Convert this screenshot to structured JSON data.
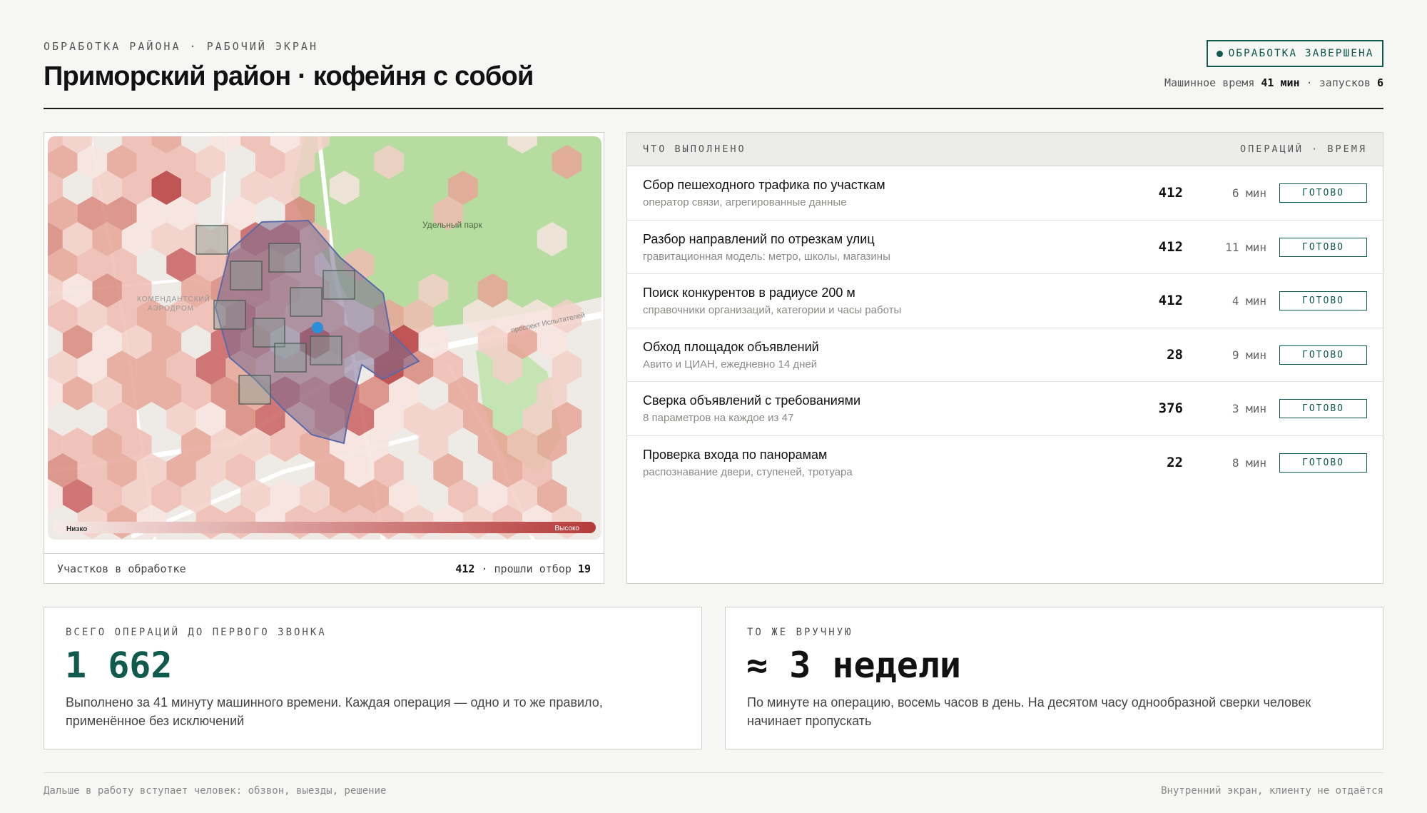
{
  "header": {
    "kicker": "ОБРАБОТКА РАЙОНА · РАБОЧИЙ ЭКРАН",
    "title": "Приморский район · кофейня с собой",
    "status_badge": "ОБРАБОТКА ЗАВЕРШЕНА",
    "machine_time_label": "Машинное время",
    "machine_time_value": "41 мин",
    "runs_label": "запусков",
    "runs_value": "6"
  },
  "map": {
    "park_label": "Удельный парк",
    "district_label_1": "КОМЕНДАНТСКИЙ",
    "district_label_2": "АЭРОДРОМ",
    "street_label": "проспект Испытателей",
    "legend_low": "Низко",
    "legend_high": "Высоко",
    "footer_label": "Участков в обработке",
    "plots_value": "412",
    "passed_label": "прошли отбор",
    "passed_value": "19"
  },
  "tasks": {
    "header_left": "ЧТО ВЫПОЛНЕНО",
    "header_right": "ОПЕРАЦИЙ · ВРЕМЯ",
    "rows": [
      {
        "title": "Сбор пешеходного трафика по участкам",
        "subtitle": "оператор связи, агрегированные данные",
        "operations": "412",
        "time": "6 мин",
        "status": "ГОТОВО"
      },
      {
        "title": "Разбор направлений по отрезкам улиц",
        "subtitle": "гравитационная модель: метро, школы, магазины",
        "operations": "412",
        "time": "11 мин",
        "status": "ГОТОВО"
      },
      {
        "title": "Поиск конкурентов в радиусе 200 м",
        "subtitle": "справочники организаций, категории и часы работы",
        "operations": "412",
        "time": "4 мин",
        "status": "ГОТОВО"
      },
      {
        "title": "Обход площадок объявлений",
        "subtitle": "Авито и ЦИАН, ежедневно 14 дней",
        "operations": "28",
        "time": "9 мин",
        "status": "ГОТОВО"
      },
      {
        "title": "Сверка объявлений с требованиями",
        "subtitle": "8 параметров на каждое из 47",
        "operations": "376",
        "time": "3 мин",
        "status": "ГОТОВО"
      },
      {
        "title": "Проверка входа по панорамам",
        "subtitle": "распознавание двери, ступеней, тротуара",
        "operations": "22",
        "time": "8 мин",
        "status": "ГОТОВО"
      }
    ]
  },
  "stats": {
    "left": {
      "label": "ВСЕГО ОПЕРАЦИЙ ДО ПЕРВОГО ЗВОНКА",
      "value": "1 662",
      "description": "Выполнено за 41 минуту машинного времени. Каждая операция — одно и то же правило, применённое без исключений"
    },
    "right": {
      "label": "ТО ЖЕ ВРУЧНУЮ",
      "value": "≈ 3 недели",
      "description": "По минуте на операцию, восемь часов в день. На десятом часу однообразной сверки человек начинает пропускать"
    }
  },
  "footer": {
    "left": "Дальше в работу вступает человек: обзвон, выезды, решение",
    "right": "Внутренний экран, клиенту не отдаётся"
  },
  "colors": {
    "accent": "#0f5a4c",
    "heat_low": "#f3d0c8",
    "heat_high": "#b63b3b",
    "park": "#b6dca0",
    "selection": "#6b5a7c"
  },
  "icons": {
    "status": "status-dot-icon"
  }
}
